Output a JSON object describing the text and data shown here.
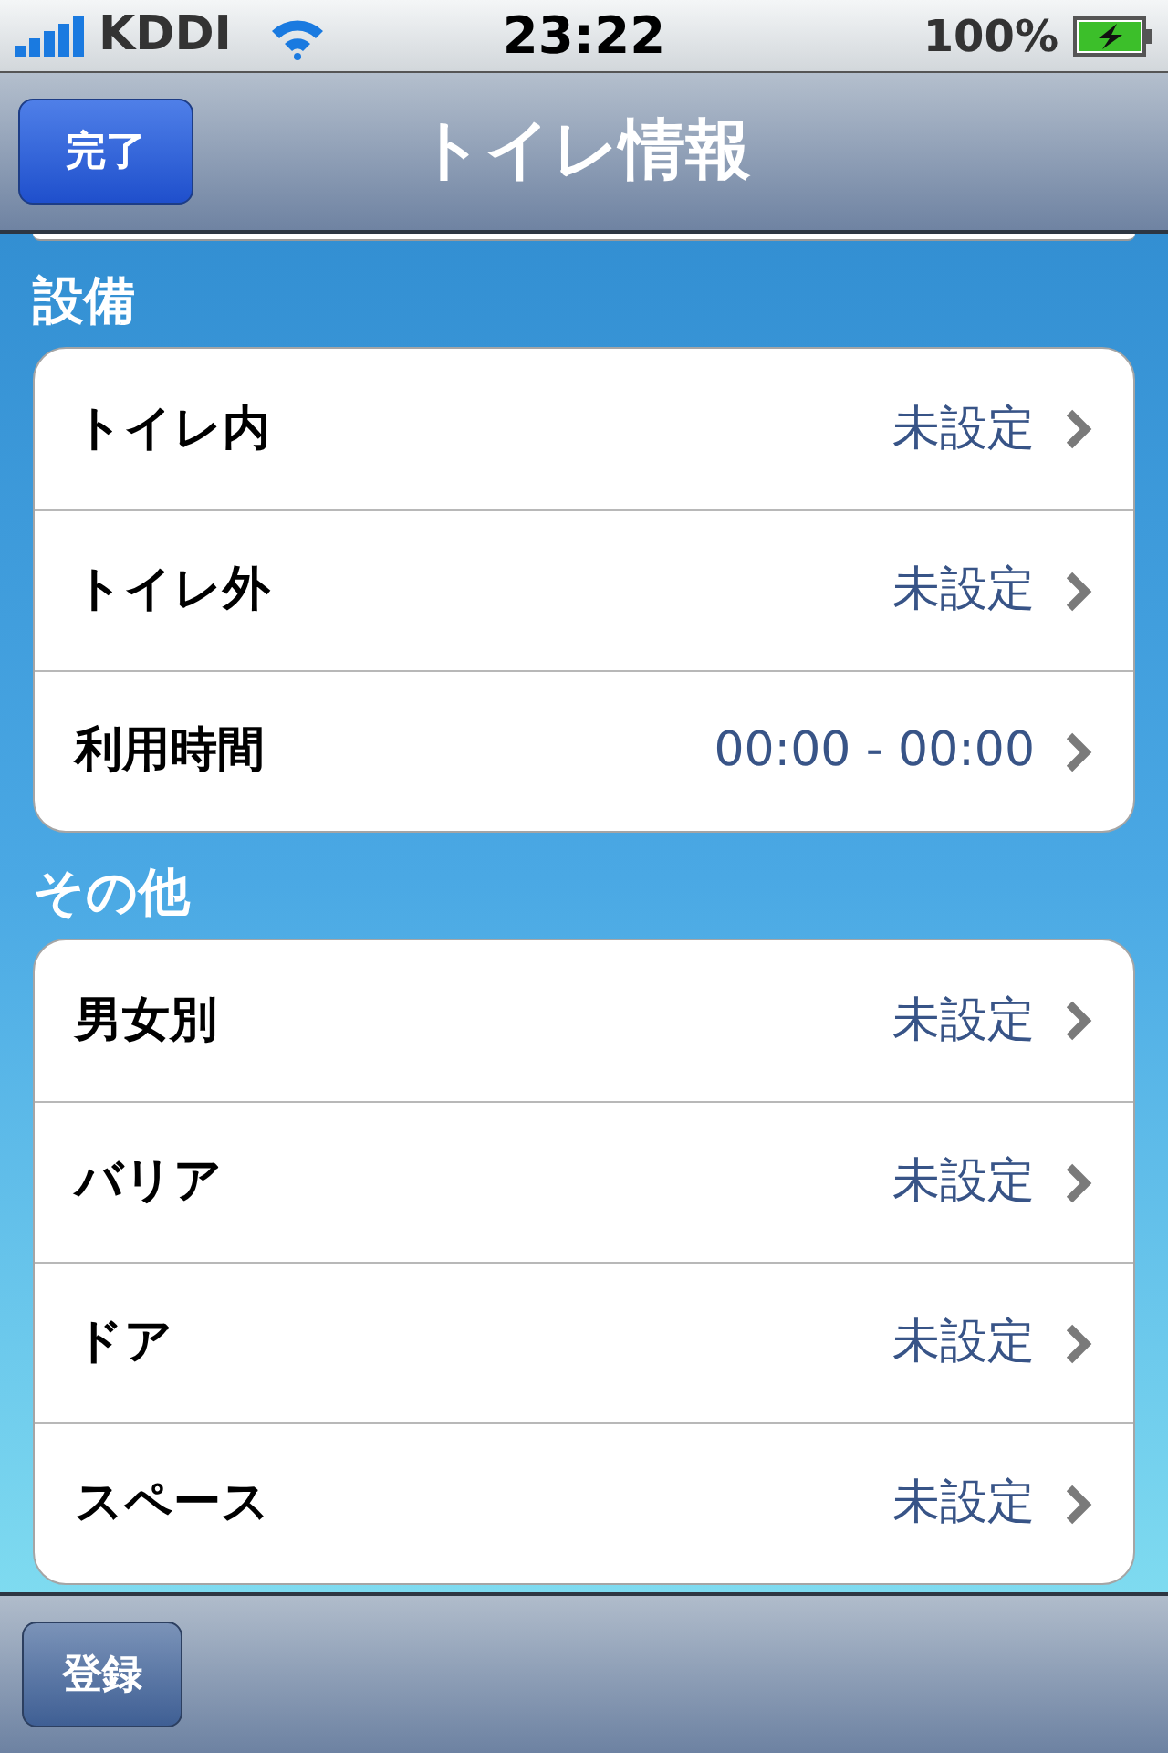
{
  "status_bar": {
    "carrier": "KDDI",
    "time": "23:22",
    "battery": "100%"
  },
  "nav_bar": {
    "done_button": "完了",
    "title": "トイレ情報"
  },
  "sections": [
    {
      "header": "設備",
      "rows": [
        {
          "label": "トイレ内",
          "value": "未設定"
        },
        {
          "label": "トイレ外",
          "value": "未設定"
        },
        {
          "label": "利用時間",
          "value": "00:00 - 00:00"
        }
      ]
    },
    {
      "header": "その他",
      "rows": [
        {
          "label": "男女別",
          "value": "未設定"
        },
        {
          "label": "バリア",
          "value": "未設定"
        },
        {
          "label": "ドア",
          "value": "未設定"
        },
        {
          "label": "スペース",
          "value": "未設定"
        }
      ]
    }
  ],
  "toolbar": {
    "register_button": "登録"
  }
}
